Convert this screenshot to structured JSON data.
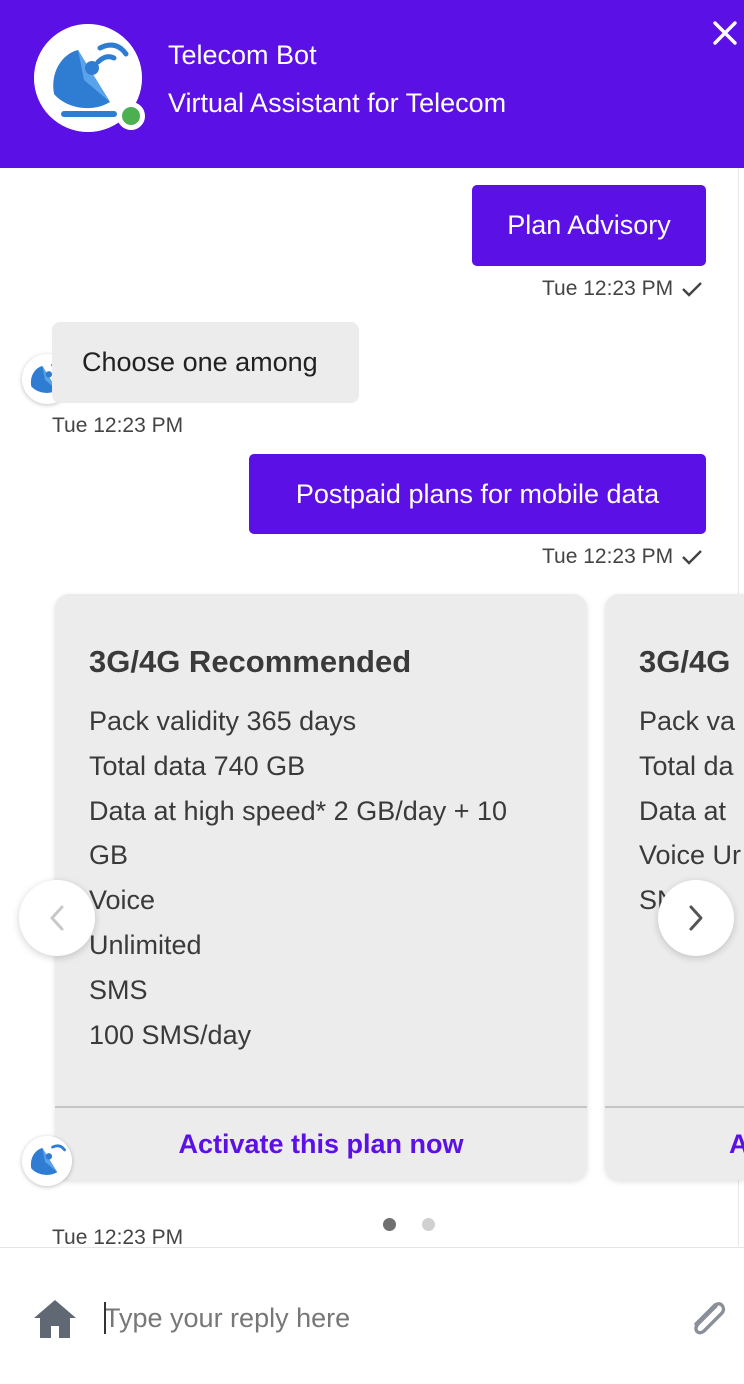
{
  "header": {
    "title": "Telecom Bot",
    "subtitle": "Virtual Assistant for Telecom",
    "background_color": "#5b10e6",
    "status_color": "#4caf50",
    "close_icon": "close-icon"
  },
  "messages": {
    "user_1": {
      "text": "Plan Advisory",
      "time": "Tue 12:23 PM"
    },
    "bot_1": {
      "text": "Choose one among",
      "time": "Tue 12:23 PM"
    },
    "user_2": {
      "text": "Postpaid plans for mobile data",
      "time": "Tue 12:23 PM"
    },
    "carousel_time": "Tue 12:23 PM"
  },
  "carousel": {
    "cards": [
      {
        "title": "3G/4G Recommended",
        "lines": [
          "Pack validity 365 days",
          "Total data 740 GB",
          "Data at high speed* 2 GB/day + 10 GB",
          "Voice",
          "Unlimited",
          "SMS",
          "100 SMS/day"
        ],
        "action": "Activate this plan now"
      },
      {
        "title": "3G/4G",
        "lines": [
          "Pack va",
          "Total da",
          "Data at",
          "Voice Ur",
          "SN"
        ],
        "action": "A"
      }
    ],
    "pagination": {
      "count": 2,
      "active_index": 0,
      "active_color": "#707070",
      "inactive_color": "#d0d0d0"
    }
  },
  "composer": {
    "placeholder": "Type your reply here",
    "home_icon": "home-icon",
    "attach_icon": "paperclip-icon"
  },
  "colors": {
    "accent": "#5b10e6",
    "bubble_bot": "#ececec",
    "card": "#ececec"
  }
}
